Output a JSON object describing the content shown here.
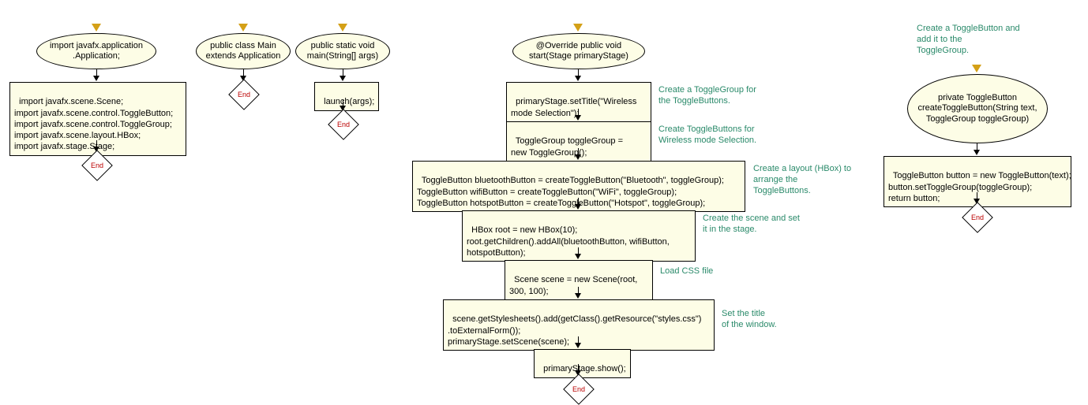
{
  "col1": {
    "ellipse": "import javafx.application\n.Application;",
    "rect": "import javafx.scene.Scene;\nimport javafx.scene.control.ToggleButton;\nimport javafx.scene.control.ToggleGroup;\nimport javafx.scene.layout.HBox;\nimport javafx.stage.Stage;",
    "end": "End"
  },
  "col2": {
    "ellipse": "public class Main\nextends Application",
    "end": "End"
  },
  "col3": {
    "ellipse": "public static void\nmain(String[] args)",
    "rect": "launch(args);",
    "end": "End"
  },
  "col4": {
    "ellipse": "@Override public void\nstart(Stage primaryStage)",
    "r1": "primaryStage.setTitle(\"Wireless\nmode Selection\");",
    "r2": "ToggleGroup toggleGroup =\nnew ToggleGroup();",
    "r3": "ToggleButton bluetoothButton = createToggleButton(\"Bluetooth\", toggleGroup);\nToggleButton wifiButton = createToggleButton(\"WiFi\", toggleGroup);\nToggleButton hotspotButton = createToggleButton(\"Hotspot\", toggleGroup);",
    "r4": "HBox root = new HBox(10);\nroot.getChildren().addAll(bluetoothButton, wifiButton,\nhotspotButton);",
    "r5": "Scene scene = new Scene(root,\n300, 100);",
    "r6": "scene.getStylesheets().add(getClass().getResource(\"styles.css\")\n.toExternalForm());\nprimaryStage.setScene(scene);",
    "r7": "primaryStage.show();",
    "end": "End",
    "c1": "Create a ToggleGroup for\nthe ToggleButtons.",
    "c2": "Create ToggleButtons for\nWireless mode Selection.",
    "c3": "Create a layout (HBox) to\narrange the\nToggleButtons.",
    "c4": "Create the scene and set\nit in the stage.",
    "c5": "Load CSS file",
    "c6": "Set the title\nof the window."
  },
  "col5": {
    "comment": "Create a ToggleButton and\nadd it to the\nToggleGroup.",
    "ellipse": "private ToggleButton\ncreateToggleButton(String\ntext, ToggleGroup\ntoggleGroup)",
    "rect": "ToggleButton button = new ToggleButton(text);\nbutton.setToggleGroup(toggleGroup);\nreturn button;",
    "end": "End"
  }
}
